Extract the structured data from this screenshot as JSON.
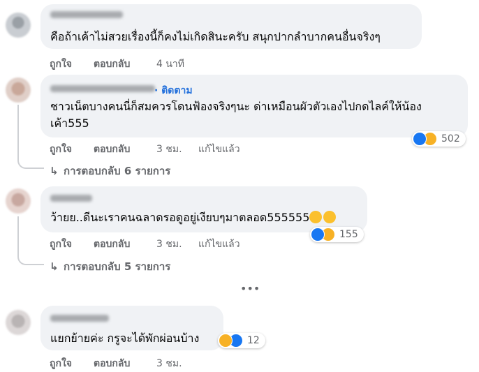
{
  "comments": [
    {
      "text_lines": [
        "คือถ้าเค้าไม่สวยเรื่องนี้ก็คงไม่เกิดสินะครับ สนุกปากลำบากคนอื่นจริงๆ"
      ],
      "like": "ถูกใจ",
      "reply": "ตอบกลับ",
      "time": "4 นาที"
    },
    {
      "follow": "· ติดตาม",
      "text_lines": [
        "ชาวเน็ตบางคนนี่ก็สมควรโดนฟ้องจริงๆนะ ด่าเหมือนผัวตัวเองไปกดไลค์ให้น้อง",
        "เค้า555"
      ],
      "like": "ถูกใจ",
      "reply": "ตอบกลับ",
      "time": "3 ชม.",
      "edited": "แก้ไขแล้ว",
      "reaction_count": "502",
      "replies_label": "การตอบกลับ 6 รายการ"
    },
    {
      "text_lines": [
        "ว้ายย..ดีนะเราคนฉลาดรอดูอยู่เงียบๆมาตลอด555555"
      ],
      "like": "ถูกใจ",
      "reply": "ตอบกลับ",
      "time": "3 ชม.",
      "edited": "แก้ไขแล้ว",
      "reaction_count": "155",
      "replies_label": "การตอบกลับ 5 รายการ"
    },
    {
      "text_lines": [
        "แยกย้ายค่ะ กรูจะได้พักผ่อนบ้าง"
      ],
      "like": "ถูกใจ",
      "reply": "ตอบกลับ",
      "time": "3 ชม.",
      "reaction_count": "12"
    }
  ],
  "more_icon": "ellipsis-icon",
  "colors": {
    "bubble": "#f0f2f5",
    "meta": "#65676b",
    "follow": "#216fdb",
    "like": "#1877f2",
    "haha": "#f7b125"
  }
}
